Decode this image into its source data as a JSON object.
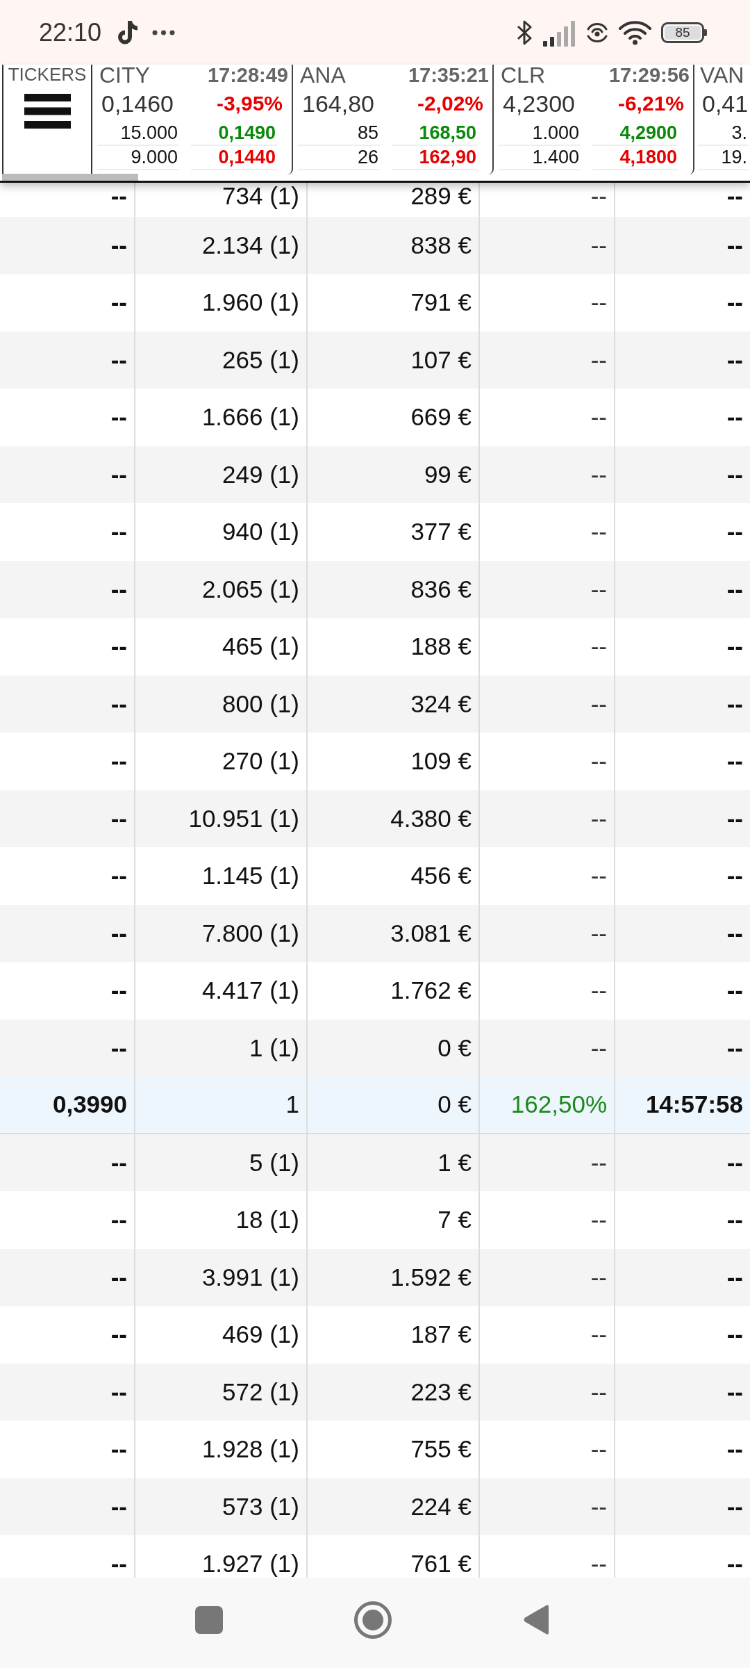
{
  "status_bar": {
    "time": "22:10",
    "battery": "85"
  },
  "tickers_menu": {
    "label": "TICKERS"
  },
  "tickers": [
    {
      "symbol": "CITY",
      "time": "17:28:49",
      "price": "0,1460",
      "change": "-3,95%",
      "color": "#e60000",
      "levels": [
        {
          "quantity": "15.000",
          "price": "0,1490",
          "color": "#0a8a0a"
        },
        {
          "quantity": "9.000",
          "price": "0,1440",
          "color": "#e60000"
        }
      ]
    },
    {
      "symbol": "ANA",
      "time": "17:35:21",
      "price": "164,80",
      "change": "-2,02%",
      "color": "#e60000",
      "levels": [
        {
          "quantity": "85",
          "price": "168,50",
          "color": "#0a8a0a"
        },
        {
          "quantity": "26",
          "price": "162,90",
          "color": "#e60000"
        }
      ]
    },
    {
      "symbol": "CLR",
      "time": "17:29:56",
      "price": "4,2300",
      "change": "-6,21%",
      "color": "#e60000",
      "levels": [
        {
          "quantity": "1.000",
          "price": "4,2900",
          "color": "#0a8a0a"
        },
        {
          "quantity": "1.400",
          "price": "4,1800",
          "color": "#e60000"
        }
      ]
    },
    {
      "symbol": "VAN",
      "price": "0,41",
      "levels": [
        {
          "quantity": "3."
        },
        {
          "quantity": "19."
        }
      ]
    }
  ],
  "table": {
    "rows": [
      {
        "cells": [
          "--",
          "734 (1)",
          "289 €",
          "--",
          "--"
        ],
        "highlighted": false
      },
      {
        "cells": [
          "--",
          "2.134 (1)",
          "838 €",
          "--",
          "--"
        ],
        "highlighted": false
      },
      {
        "cells": [
          "--",
          "1.960 (1)",
          "791 €",
          "--",
          "--"
        ],
        "highlighted": false
      },
      {
        "cells": [
          "--",
          "265 (1)",
          "107 €",
          "--",
          "--"
        ],
        "highlighted": false
      },
      {
        "cells": [
          "--",
          "1.666 (1)",
          "669 €",
          "--",
          "--"
        ],
        "highlighted": false
      },
      {
        "cells": [
          "--",
          "249 (1)",
          "99 €",
          "--",
          "--"
        ],
        "highlighted": false
      },
      {
        "cells": [
          "--",
          "940 (1)",
          "377 €",
          "--",
          "--"
        ],
        "highlighted": false
      },
      {
        "cells": [
          "--",
          "2.065 (1)",
          "836 €",
          "--",
          "--"
        ],
        "highlighted": false
      },
      {
        "cells": [
          "--",
          "465 (1)",
          "188 €",
          "--",
          "--"
        ],
        "highlighted": false
      },
      {
        "cells": [
          "--",
          "800 (1)",
          "324 €",
          "--",
          "--"
        ],
        "highlighted": false
      },
      {
        "cells": [
          "--",
          "270 (1)",
          "109 €",
          "--",
          "--"
        ],
        "highlighted": false
      },
      {
        "cells": [
          "--",
          "10.951 (1)",
          "4.380 €",
          "--",
          "--"
        ],
        "highlighted": false
      },
      {
        "cells": [
          "--",
          "1.145 (1)",
          "456 €",
          "--",
          "--"
        ],
        "highlighted": false
      },
      {
        "cells": [
          "--",
          "7.800 (1)",
          "3.081 €",
          "--",
          "--"
        ],
        "highlighted": false
      },
      {
        "cells": [
          "--",
          "4.417 (1)",
          "1.762 €",
          "--",
          "--"
        ],
        "highlighted": false
      },
      {
        "cells": [
          "--",
          "1 (1)",
          "0 €",
          "--",
          "--"
        ],
        "highlighted": false
      },
      {
        "cells": [
          "0,3990",
          "1",
          "0 €",
          "162,50%",
          "14:57:58"
        ],
        "highlighted": true,
        "color": "#1a8a1a"
      },
      {
        "cells": [
          "--",
          "5 (1)",
          "1 €",
          "--",
          "--"
        ],
        "highlighted": false
      },
      {
        "cells": [
          "--",
          "18 (1)",
          "7 €",
          "--",
          "--"
        ],
        "highlighted": false
      },
      {
        "cells": [
          "--",
          "3.991 (1)",
          "1.592 €",
          "--",
          "--"
        ],
        "highlighted": false
      },
      {
        "cells": [
          "--",
          "469 (1)",
          "187 €",
          "--",
          "--"
        ],
        "highlighted": false
      },
      {
        "cells": [
          "--",
          "572 (1)",
          "223 €",
          "--",
          "--"
        ],
        "highlighted": false
      },
      {
        "cells": [
          "--",
          "1.928 (1)",
          "755 €",
          "--",
          "--"
        ],
        "highlighted": false
      },
      {
        "cells": [
          "--",
          "573 (1)",
          "224 €",
          "--",
          "--"
        ],
        "highlighted": false
      },
      {
        "cells": [
          "--",
          "1.927 (1)",
          "761 €",
          "--",
          "--"
        ],
        "highlighted": false
      }
    ]
  }
}
